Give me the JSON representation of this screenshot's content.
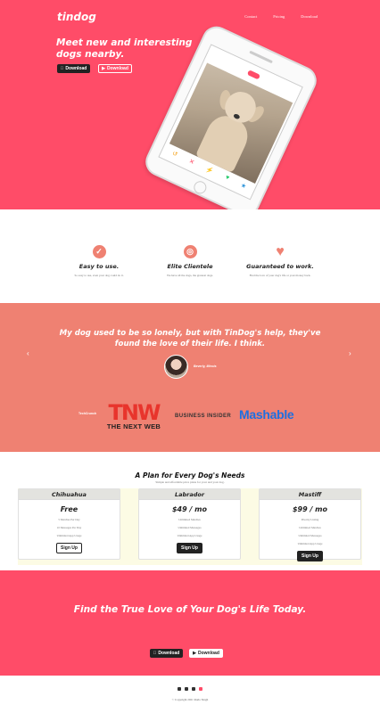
{
  "brand": "tindog",
  "nav": [
    "Contact",
    "Pricing",
    "Download"
  ],
  "hero": {
    "title": "Meet new and interesting dogs nearby.",
    "download_apple": "Download",
    "download_play": "Download"
  },
  "features": [
    {
      "icon": "check-circle-icon",
      "title": "Easy to use.",
      "text": "So easy to use, even your dog could do it."
    },
    {
      "icon": "bullseye-icon",
      "title": "Elite Clientele",
      "text": "We have all the dogs, the greatest dogs."
    },
    {
      "icon": "heart-icon",
      "title": "Guaranteed to work.",
      "text": "Find the love of your dog's life or your money back."
    }
  ],
  "testimonial": {
    "quote": "My dog used to be so lonely, but with TinDog's help, they've found the love of their life. I think.",
    "author": "Beverly, Illinois"
  },
  "press": {
    "techcrunch": "TechCrunch",
    "tnw_big": "TNW",
    "tnw_small": "THE NEXT WEB",
    "business_insider": "BUSINESS INSIDER",
    "mashable": "Mashable"
  },
  "pricing": {
    "title": "A Plan for Every Dog's Needs",
    "subtitle": "Simple and affordable price plans for your and your dog.",
    "plans": [
      {
        "name": "Chihuahua",
        "price": "Free",
        "features": [
          "5 Matches Per Day",
          "10 Messages Per Day",
          "Unlimited App Usage"
        ],
        "button": "Sign Up",
        "style": "outline"
      },
      {
        "name": "Labrador",
        "price": "$49 / mo",
        "features": [
          "Unlimited Matches",
          "Unlimited Messages",
          "Unlimited App Usage"
        ],
        "button": "Sign Up",
        "style": "dark"
      },
      {
        "name": "Mastiff",
        "price": "$99 / mo",
        "features": [
          "Priority Listing",
          "Unlimited Matches",
          "Unlimited Messages",
          "Unlimited App Usage"
        ],
        "button": "Sign Up",
        "style": "dark"
      }
    ]
  },
  "cta": {
    "title": "Find the True Love of Your Dog's Life Today.",
    "download_apple": "Download",
    "download_play": "Download"
  },
  "footer": {
    "copyright": "© Copyright 2021 Rudo Singh"
  },
  "colors": {
    "primary": "#ff4c68",
    "secondary": "#ef8172",
    "dark": "#222222"
  }
}
